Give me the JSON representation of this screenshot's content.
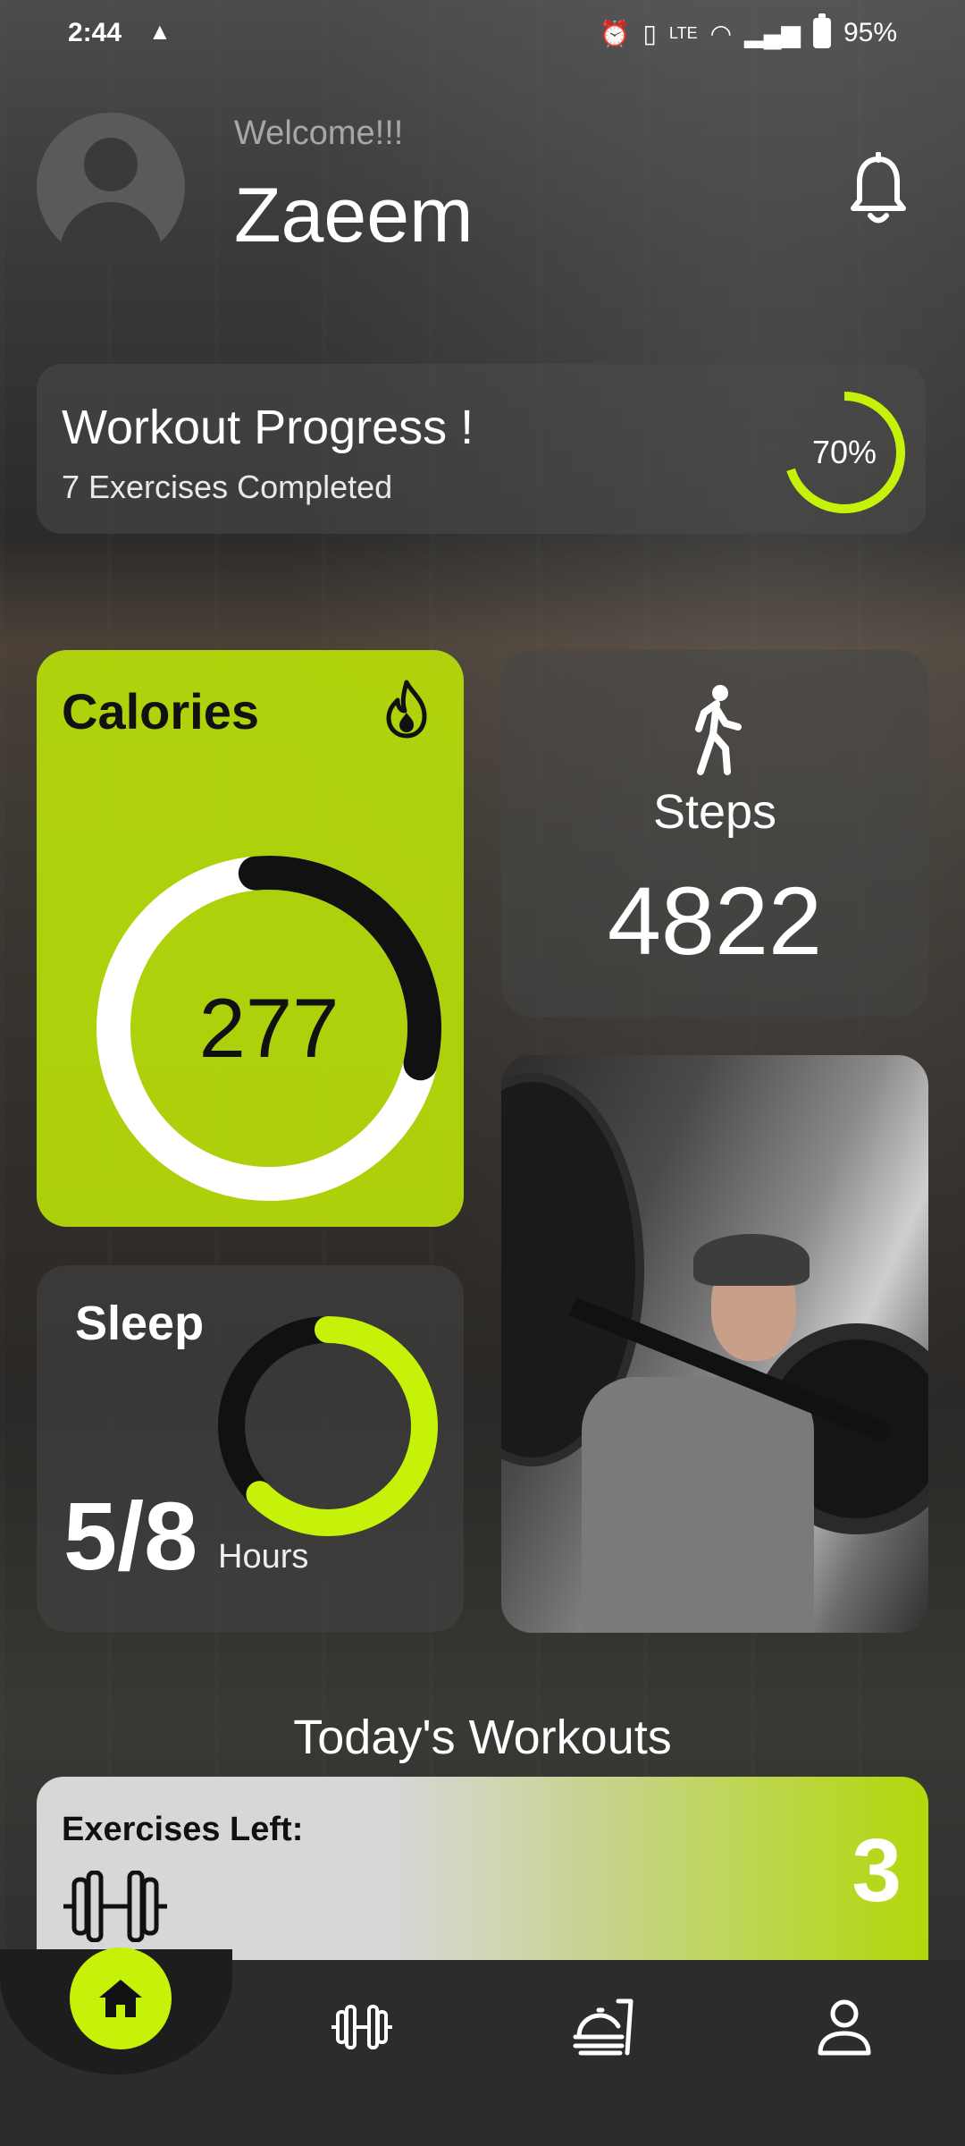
{
  "status_bar": {
    "time": "2:44",
    "alert_icon": "warning-icon",
    "battery": "95%"
  },
  "header": {
    "welcome": "Welcome!!!",
    "username": "Zaeem",
    "notification_icon": "bell-icon"
  },
  "workout_progress": {
    "title": "Workout Progress !",
    "subtitle": "7 Exercises Completed",
    "percent_label": "70%",
    "percent_value": 0.7
  },
  "calories": {
    "title": "Calories",
    "value": "277",
    "icon": "flame-icon",
    "ring_fraction": 0.3
  },
  "steps": {
    "label": "Steps",
    "value": "4822",
    "icon": "walking-person-icon"
  },
  "sleep": {
    "title": "Sleep",
    "value": "5/8",
    "unit": "Hours",
    "fraction": 0.625
  },
  "todays_workouts": {
    "title": "Today's Workouts",
    "exercises_left_label": "Exercises Left:",
    "exercises_left_count": "3"
  },
  "bottom_nav": {
    "items": [
      "home-icon",
      "dumbbell-icon",
      "food-tray-icon",
      "profile-icon"
    ],
    "active": "home-icon"
  },
  "colors": {
    "accent": "#c6f20a",
    "card_accent": "#b7de08"
  }
}
